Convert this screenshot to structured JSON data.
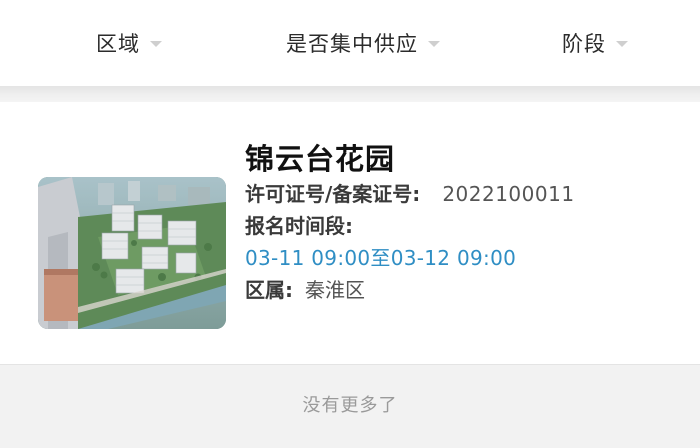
{
  "filters": [
    {
      "label": "区域"
    },
    {
      "label": "是否集中供应"
    },
    {
      "label": "阶段"
    }
  ],
  "listing": {
    "name": "锦云台花园",
    "permit_label": "许可证号/备案证号:",
    "permit_number": "2022100011",
    "registration_label": "报名时间段:",
    "registration_period": "03-11 09:00至03-12 09:00",
    "district_label": "区属:",
    "district": "秦淮区"
  },
  "footer": {
    "end_text": "没有更多了"
  },
  "colors": {
    "accent_time": "#2f8ec4",
    "dropdown_caret": "#cfcfcf",
    "footer_bg": "#f2f2f2"
  },
  "icons": {
    "dropdown": "caret-down-icon"
  }
}
